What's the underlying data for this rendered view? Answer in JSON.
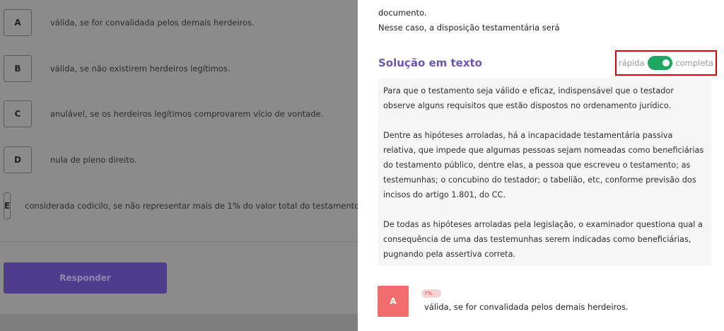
{
  "options": [
    {
      "letter": "A",
      "text": "válida, se for convalidada pelos demais herdeiros."
    },
    {
      "letter": "B",
      "text": "válida, se não existirem herdeiros legítimos."
    },
    {
      "letter": "C",
      "text": "anulável, se os herdeiros legítimos comprovarem vício de vontade."
    },
    {
      "letter": "D",
      "text": "nula de pleno direito."
    },
    {
      "letter": "E",
      "text": "considerada codicilo, se não representar mais de 1% do valor total do testamento."
    }
  ],
  "respond_button": "Responder",
  "statement": {
    "line1": "documento.",
    "line2": "Nesse caso, a disposição testamentária será"
  },
  "solution": {
    "title": "Solução em texto",
    "toggle_left": "rápida",
    "toggle_right": "completa",
    "toggle_state": "completa",
    "paragraphs": [
      "Para que o testamento seja válido e eficaz, indispensável que o testador observe alguns requisitos que estão dispostos no ordenamento jurídico.",
      "Dentre as hipóteses arroladas, há a incapacidade testamentária passiva relativa, que impede que algumas pessoas sejam nomeadas como beneficiárias do testamento público, dentre elas, a pessoa que escreveu o testamento; as testemunhas; o concubino do testador; o tabelião, etc, conforme previsão dos incisos do artigo 1.801, do CC.",
      "De todas as hipóteses arroladas pela legislação, o examinador questiona qual a consequência de uma das testemunhas serem indicadas como beneficiárias, pugnando pela assertiva correta."
    ]
  },
  "answer_stat": {
    "letter": "A",
    "percent": "7%",
    "text": "válida, se for convalidada pelos demais herdeiros.",
    "color": "#f16d6d"
  },
  "colors": {
    "accent": "#6c55b8",
    "toggle_on": "#1fa860",
    "highlight": "#e00000"
  }
}
